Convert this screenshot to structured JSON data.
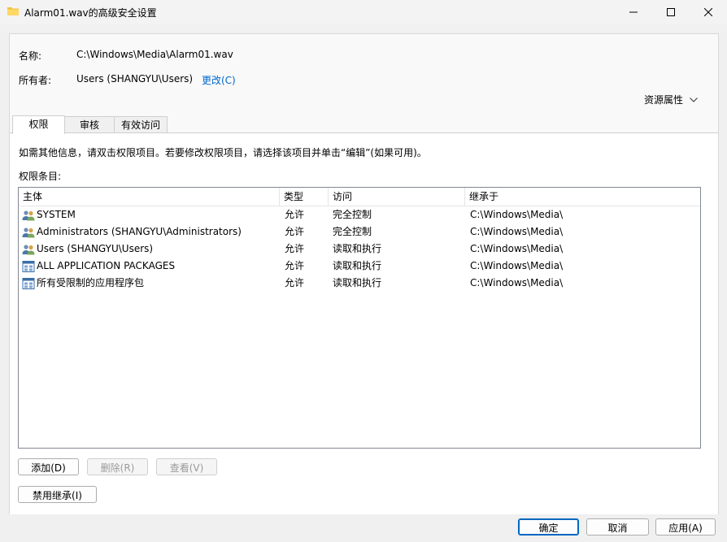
{
  "window": {
    "title": "Alarm01.wav的高级安全设置"
  },
  "fields": {
    "name_label": "名称:",
    "name_value": "C:\\Windows\\Media\\Alarm01.wav",
    "owner_label": "所有者:",
    "owner_value": "Users (SHANGYU\\Users)",
    "change_link": "更改(C)",
    "resource_props": "资源属性"
  },
  "tabs": [
    {
      "label": "权限",
      "active": true
    },
    {
      "label": "审核",
      "active": false
    },
    {
      "label": "有效访问",
      "active": false
    }
  ],
  "permissions": {
    "info": "如需其他信息，请双击权限项目。若要修改权限项目，请选择该项目并单击“编辑”(如果可用)。",
    "entries_label": "权限条目:",
    "columns": [
      "主体",
      "类型",
      "访问",
      "继承于"
    ],
    "rows": [
      {
        "icon": "users-icon",
        "principal": "SYSTEM",
        "type": "允许",
        "access": "完全控制",
        "inherited": "C:\\Windows\\Media\\"
      },
      {
        "icon": "users-icon",
        "principal": "Administrators (SHANGYU\\Administrators)",
        "type": "允许",
        "access": "完全控制",
        "inherited": "C:\\Windows\\Media\\"
      },
      {
        "icon": "users-icon",
        "principal": "Users (SHANGYU\\Users)",
        "type": "允许",
        "access": "读取和执行",
        "inherited": "C:\\Windows\\Media\\"
      },
      {
        "icon": "package-icon",
        "principal": "ALL APPLICATION PACKAGES",
        "type": "允许",
        "access": "读取和执行",
        "inherited": "C:\\Windows\\Media\\"
      },
      {
        "icon": "package-icon",
        "principal": "所有受限制的应用程序包",
        "type": "允许",
        "access": "读取和执行",
        "inherited": "C:\\Windows\\Media\\"
      }
    ]
  },
  "buttons": {
    "add": "添加(D)",
    "remove": "删除(R)",
    "view": "查看(V)",
    "disable_inheritance": "禁用继承(I)",
    "ok": "确定",
    "cancel": "取消",
    "apply": "应用(A)"
  },
  "colors": {
    "link": "#0066cc",
    "accent": "#0067c0"
  }
}
